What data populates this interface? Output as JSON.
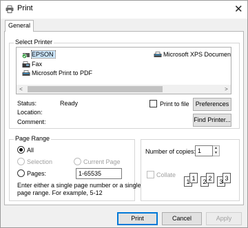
{
  "window": {
    "title": "Print",
    "close_glyph": "✕"
  },
  "tabs": [
    {
      "label": "General"
    }
  ],
  "select_printer": {
    "group_title": "Select Printer",
    "printers": [
      {
        "name": "EPSON",
        "icon": "printer-default-icon",
        "selected": true
      },
      {
        "name": "Fax",
        "icon": "fax-icon",
        "selected": false
      },
      {
        "name": "Microsoft Print to PDF",
        "icon": "printer-icon",
        "selected": false
      },
      {
        "name": "Microsoft XPS Documen",
        "icon": "printer-icon",
        "selected": false
      }
    ],
    "scroll_left": "<",
    "scroll_right": ">",
    "status_label": "Status:",
    "status_value": "Ready",
    "location_label": "Location:",
    "comment_label": "Comment:",
    "print_to_file_label": "Print to file",
    "preferences_label": "Preferences",
    "find_printer_label": "Find Printer..."
  },
  "page_range": {
    "group_title": "Page Range",
    "all_label": "All",
    "selection_label": "Selection",
    "current_page_label": "Current Page",
    "pages_label": "Pages:",
    "pages_value": "1-65535",
    "hint_line1": "Enter either a single page number or a single",
    "hint_line2": "page range.  For example, 5-12"
  },
  "copies": {
    "number_label": "Number of copies:",
    "number_value": "1",
    "collate_label": "Collate",
    "collate_pages": [
      "1",
      "1",
      "2",
      "2",
      "3",
      "3"
    ]
  },
  "buttons": {
    "print": "Print",
    "cancel": "Cancel",
    "apply": "Apply"
  }
}
